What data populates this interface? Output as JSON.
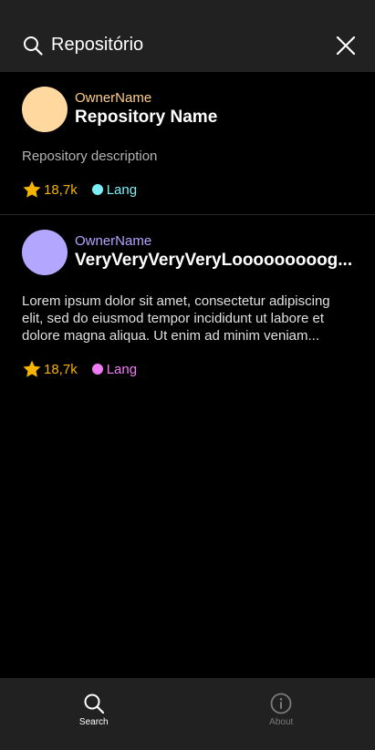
{
  "search": {
    "value": "Repositório",
    "icon": "search-icon",
    "close_icon": "close-icon"
  },
  "repos": [
    {
      "owner": "OwnerName",
      "name": "Repository Name",
      "description": "Repository description",
      "stars": "18,7k",
      "lang": "Lang",
      "avatar_color": "#FFD8A0",
      "owner_color": "#FFCE8A",
      "lang_color": "#7BEFF5"
    },
    {
      "owner": "OwnerName",
      "name": "VeryVeryVeryVeryLooooooooog...",
      "description": "Lorem ipsum dolor sit amet, consectetur adipiscing elit, sed do eiusmod tempor incididunt ut labore et dolore magna aliqua. Ut enim ad minim veniam...",
      "stars": "18,7k",
      "lang": "Lang",
      "avatar_color": "#B3A6FF",
      "owner_color": "#B3A6FF",
      "lang_color": "#F07CF5"
    }
  ],
  "colors": {
    "star": "#F5B400",
    "background": "#000000",
    "bars": "#212121"
  },
  "nav": {
    "search_label": "Search",
    "about_label": "About",
    "search_icon": "search-icon",
    "about_icon": "info-icon"
  }
}
